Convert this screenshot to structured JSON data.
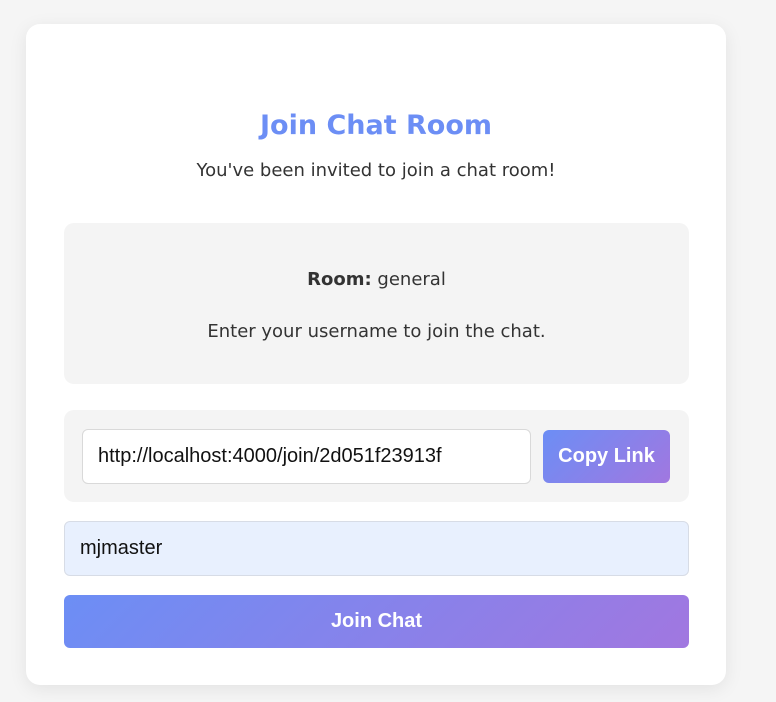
{
  "card": {
    "title": "Join Chat Room",
    "subtitle": "You've been invited to join a chat room!"
  },
  "info": {
    "room_label": "Room:",
    "room_name": "general",
    "instruction": "Enter your username to join the chat."
  },
  "share": {
    "link_value": "http://localhost:4000/join/2d051f23913f",
    "copy_label": "Copy Link"
  },
  "form": {
    "username_value": "mjmaster",
    "join_label": "Join Chat"
  },
  "colors": {
    "accent": "#6c8ef5",
    "gradient_end": "#a177e0",
    "panel_bg": "#f4f4f4",
    "input_autofill_bg": "#e8f0fe"
  }
}
